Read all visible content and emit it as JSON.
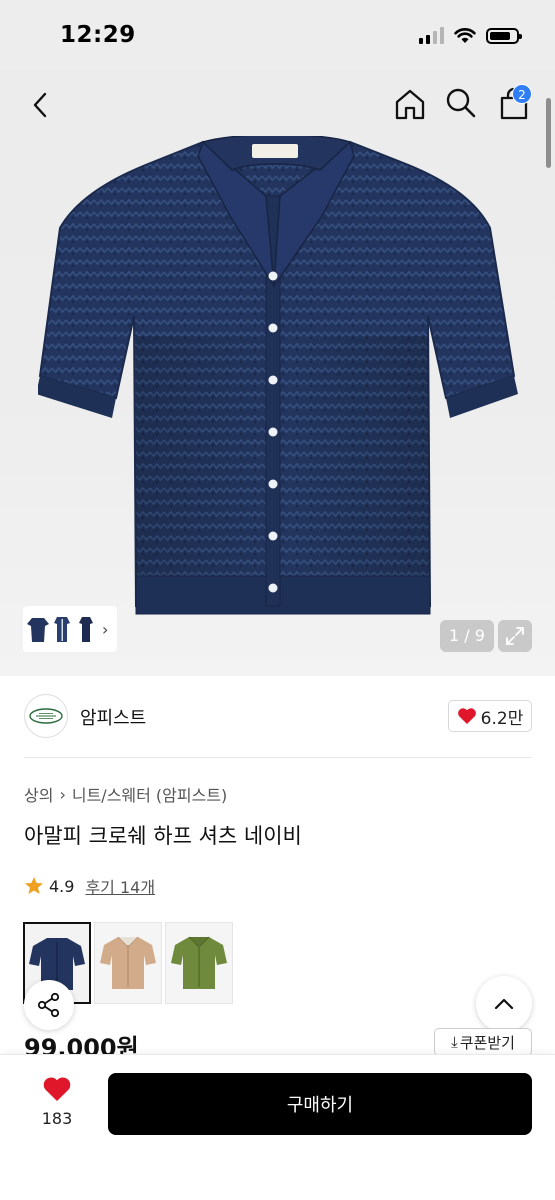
{
  "status_bar": {
    "time": "12:29",
    "battery_level": 0.8
  },
  "nav": {
    "icons": [
      "back-icon",
      "home-icon",
      "search-icon",
      "cart-icon"
    ],
    "cart_count": "2"
  },
  "gallery": {
    "counter": "1 / 9",
    "thumb_chevron": "›",
    "expand_icon": "expand-icon"
  },
  "shop": {
    "name": "암피스트",
    "likes": "6.2만"
  },
  "breadcrumb": {
    "category": "상의",
    "separator": "›",
    "subcategory": "니트/스웨터 (암피스트)"
  },
  "product": {
    "title": "아말피 크로쉐 하프 셔츠 네이비",
    "rating": "4.9",
    "reviews": "후기 14개",
    "price": "99,000원"
  },
  "colors": {
    "options": [
      {
        "name": "navy",
        "hex": "#23355e",
        "selected": true
      },
      {
        "name": "beige",
        "hex": "#d2ab8b",
        "selected": false
      },
      {
        "name": "olive",
        "hex": "#6f8a3c",
        "selected": false
      }
    ]
  },
  "actions": {
    "coupon_label": "쿠폰받기",
    "coupon_icon": "⤓",
    "wish_count": "183",
    "buy_label": "구매하기"
  },
  "theme": {
    "accent": "#2f7ef6",
    "heart": "#e0162b",
    "star": "#f0a020",
    "navy": "#23355e"
  }
}
